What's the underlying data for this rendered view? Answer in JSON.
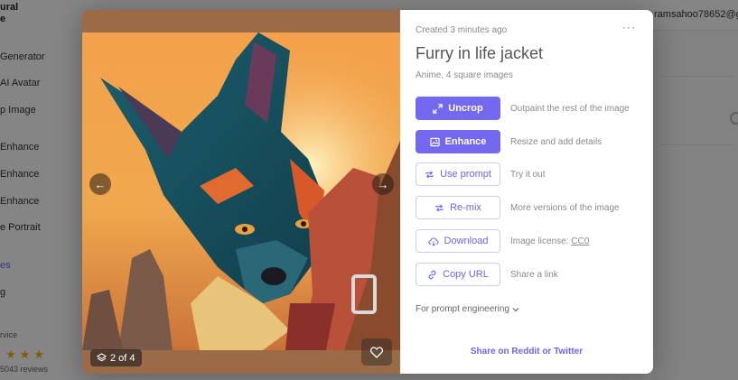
{
  "background": {
    "brand": [
      "ural",
      "e"
    ],
    "sidebar_items": [
      "Generator",
      "AI Avatar",
      "p Image",
      "Enhance",
      "Enhance",
      "Enhance",
      "e Portrait",
      "es",
      "g"
    ],
    "service_label": "rvice",
    "reviews": "5043 reviews",
    "user_email": "ramsahoo78652@g"
  },
  "modal": {
    "counter": "2 of 4",
    "created": "Created 3 minutes ago",
    "more_label": "···",
    "title": "Furry in life jacket",
    "subtitle": "Anime, 4 square images",
    "actions": [
      {
        "label": "Uncrop",
        "description": "Outpaint the rest of the image",
        "icon": "expand-icon",
        "style": "primary"
      },
      {
        "label": "Enhance",
        "description": "Resize and add details",
        "icon": "image-icon",
        "style": "primary"
      },
      {
        "label": "Use prompt",
        "description": "Try it out",
        "icon": "repeat-icon",
        "style": "outline"
      },
      {
        "label": "Re-mix",
        "description": "More versions of the image",
        "icon": "repeat-icon",
        "style": "outline"
      },
      {
        "label": "Download",
        "description": "Image license:",
        "link": "CC0",
        "icon": "cloud-download-icon",
        "style": "outline"
      },
      {
        "label": "Copy URL",
        "description": "Share a link",
        "icon": "link-icon",
        "style": "outline"
      }
    ],
    "prompt_engineering": "For prompt engineering",
    "share": "Share on Reddit or Twitter"
  },
  "colors": {
    "accent": "#7468f0",
    "accent_text": "#6c63ff"
  }
}
